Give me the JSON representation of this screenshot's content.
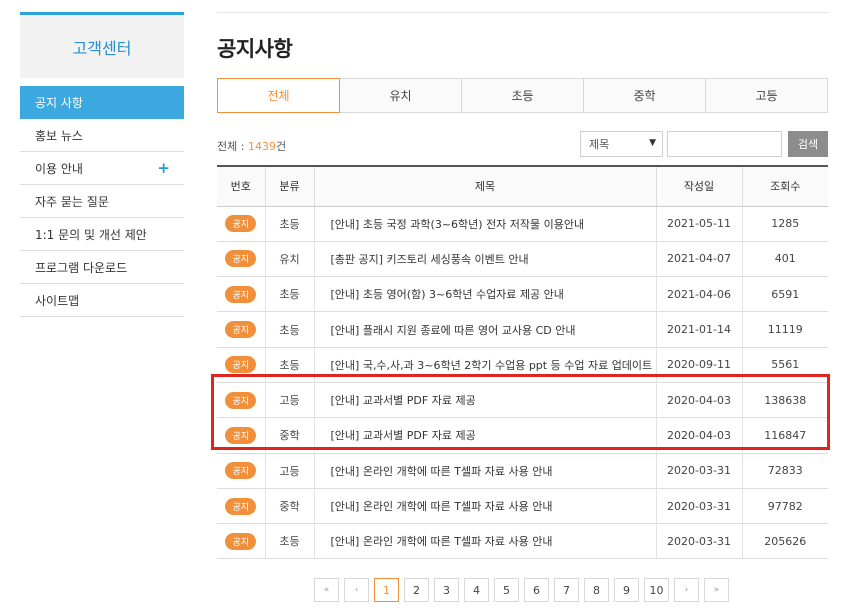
{
  "sidebar": {
    "title": "고객센터",
    "items": [
      {
        "label": "공지 사항"
      },
      {
        "label": "홍보 뉴스"
      },
      {
        "label": "이용 안내",
        "expand": "+"
      },
      {
        "label": "자주 묻는 질문"
      },
      {
        "label": "1:1 문의 및 개선 제안"
      },
      {
        "label": "프로그램 다운로드"
      },
      {
        "label": "사이트맵"
      }
    ]
  },
  "main": {
    "title": "공지사항",
    "tabs": [
      "전체",
      "유치",
      "초등",
      "중학",
      "고등"
    ],
    "total_label": "전체 : ",
    "total_count": "1439",
    "total_unit": "건",
    "search": {
      "select_value": "제목",
      "input_value": "",
      "button_label": "검색"
    },
    "table": {
      "headers": [
        "번호",
        "분류",
        "제목",
        "작성일",
        "조회수"
      ],
      "rows": [
        {
          "badge": "공지",
          "category": "초등",
          "subject": "[안내] 초등 국정 과학(3~6학년) 전자 저작물 이용안내",
          "date": "2021-05-11",
          "views": "1285"
        },
        {
          "badge": "공지",
          "category": "유치",
          "subject": "[총판 공지] 키즈토리 세싱풍속 이벤트 안내",
          "date": "2021-04-07",
          "views": "401"
        },
        {
          "badge": "공지",
          "category": "초등",
          "subject": "[안내] 초등 영어(함) 3~6학년 수업자료 제공 안내",
          "date": "2021-04-06",
          "views": "6591"
        },
        {
          "badge": "공지",
          "category": "초등",
          "subject": "[안내] 플래시 지원 종료에 따른 영어 교사용 CD 안내",
          "date": "2021-01-14",
          "views": "11119"
        },
        {
          "badge": "공지",
          "category": "초등",
          "subject": "[안내] 국,수,사,과 3~6학년 2학기 수업용 ppt 등 수업 자료 업데이트",
          "date": "2020-09-11",
          "views": "5561"
        },
        {
          "badge": "공지",
          "category": "고등",
          "subject": "[안내] 교과서별 PDF 자료 제공",
          "date": "2020-04-03",
          "views": "138638"
        },
        {
          "badge": "공지",
          "category": "중학",
          "subject": "[안내] 교과서별 PDF 자료 제공",
          "date": "2020-04-03",
          "views": "116847"
        },
        {
          "badge": "공지",
          "category": "고등",
          "subject": "[안내] 온라인 개학에 따른 T셀파 자료 사용 안내",
          "date": "2020-03-31",
          "views": "72833"
        },
        {
          "badge": "공지",
          "category": "중학",
          "subject": "[안내] 온라인 개학에 따른 T셀파 자료 사용 안내",
          "date": "2020-03-31",
          "views": "97782"
        },
        {
          "badge": "공지",
          "category": "초등",
          "subject": "[안내] 온라인 개학에 따른 T셀파 자료 사용 안내",
          "date": "2020-03-31",
          "views": "205626"
        }
      ]
    },
    "pagination": {
      "first": "«",
      "prev": "‹",
      "pages": [
        "1",
        "2",
        "3",
        "4",
        "5",
        "6",
        "7",
        "8",
        "9",
        "10"
      ],
      "next": "›",
      "last": "»"
    }
  },
  "colors": {
    "accent": "#f0903c",
    "sidebar_active": "#3ba8e0",
    "highlight": "#e0241e"
  }
}
